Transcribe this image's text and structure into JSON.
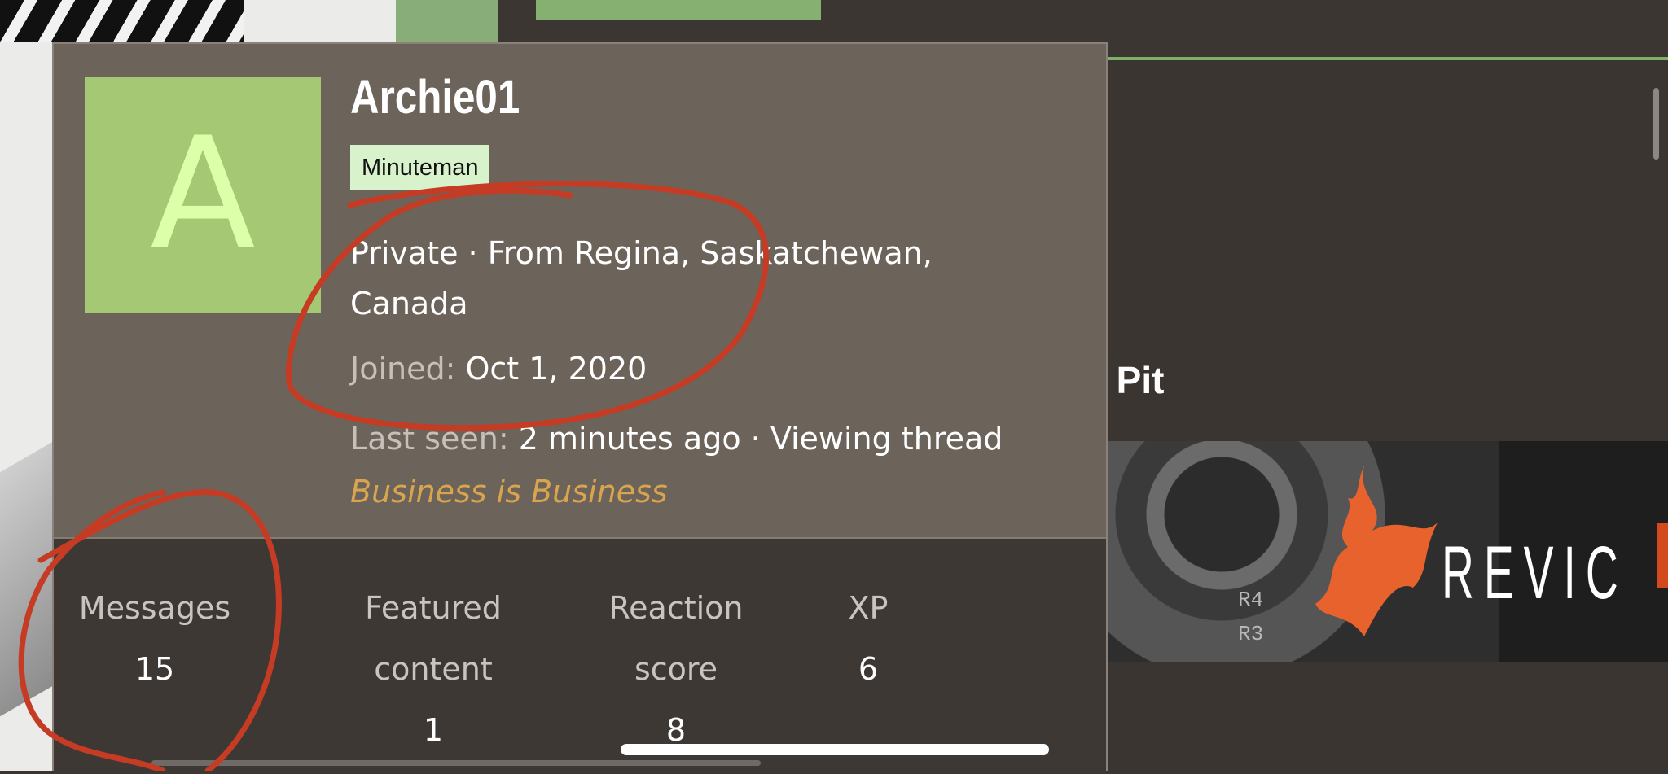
{
  "profile": {
    "avatar_letter": "A",
    "username": "Archie01",
    "badge": "Minuteman",
    "location_line1": "Private · From Regina, Saskatchewan,",
    "location_line2": "Canada",
    "joined_label": "Joined:",
    "joined_value": "Oct 1, 2020",
    "last_seen_label": "Last seen:",
    "last_seen_value": "2 minutes ago · Viewing thread",
    "tagline": "Business is Business",
    "avatar_color": "#a5c874",
    "badge_color": "#d8f3cc",
    "tagline_color": "#d9a44e"
  },
  "stats": {
    "messages": {
      "label": "Messages",
      "value": "15"
    },
    "featured": {
      "label_line1": "Featured",
      "label_line2": "content",
      "value": "1"
    },
    "reaction": {
      "label_line1": "Reaction",
      "label_line2": "score",
      "value": "8"
    },
    "xp": {
      "label": "XP",
      "value": "6"
    }
  },
  "background": {
    "heading_fragment": "r Pit",
    "banner_brand": "REVIC",
    "chip_labels": [
      "R4",
      "R3"
    ]
  },
  "annotations": {
    "color": "#c63b23",
    "shapes": [
      "red-circle-around-location-and-joined",
      "red-circle-around-messages"
    ]
  }
}
